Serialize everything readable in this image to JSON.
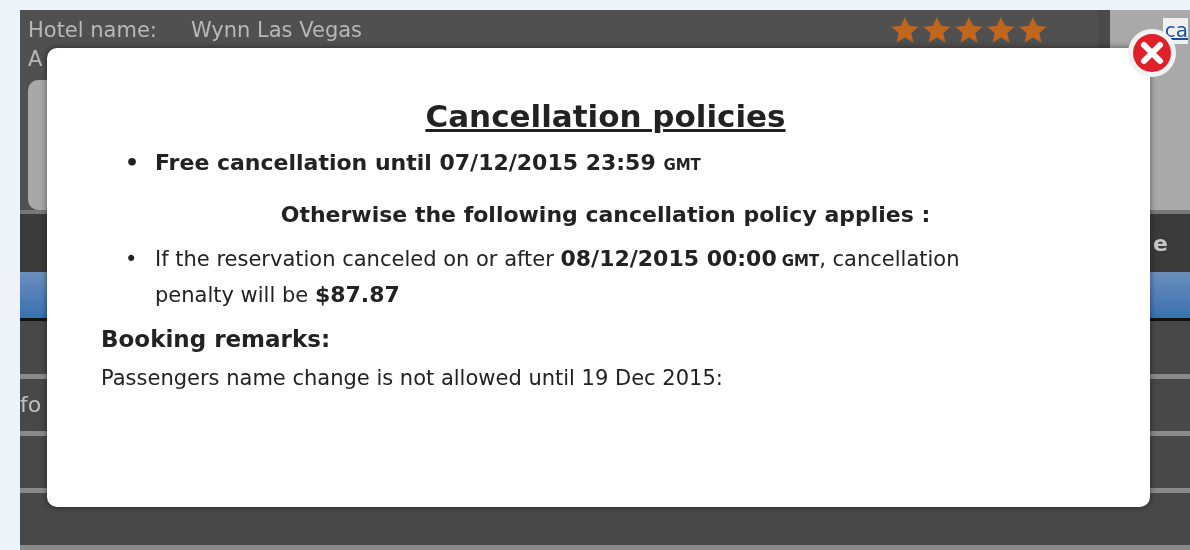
{
  "background": {
    "hotel_label": "Hotel name:",
    "hotel_name": "Wynn Las Vegas",
    "stars": 5,
    "address_label": "A",
    "side_link": "ca",
    "column_header": "e",
    "row_label": "fo"
  },
  "modal": {
    "title": "Cancellation policies",
    "free_cancellation": {
      "bullet": "•",
      "text": "Free cancellation until 07/12/2015 23:59",
      "timezone": "GMT"
    },
    "otherwise": "Otherwise the following cancellation policy applies :",
    "policies": [
      {
        "bullet": "•",
        "parts": [
          {
            "kind": "plain",
            "text": "If the reservation canceled on or after "
          },
          {
            "kind": "strong",
            "text": "08/12/2015 00:00"
          },
          {
            "kind": "timezone",
            "text": "GMT"
          },
          {
            "kind": "plain",
            "text": ", cancellation penalty will be "
          },
          {
            "kind": "strong",
            "text": "$87.87"
          }
        ]
      }
    ],
    "remarks_title": "Booking remarks:",
    "remarks": "Passengers name change is not allowed until 19 Dec 2015:"
  }
}
